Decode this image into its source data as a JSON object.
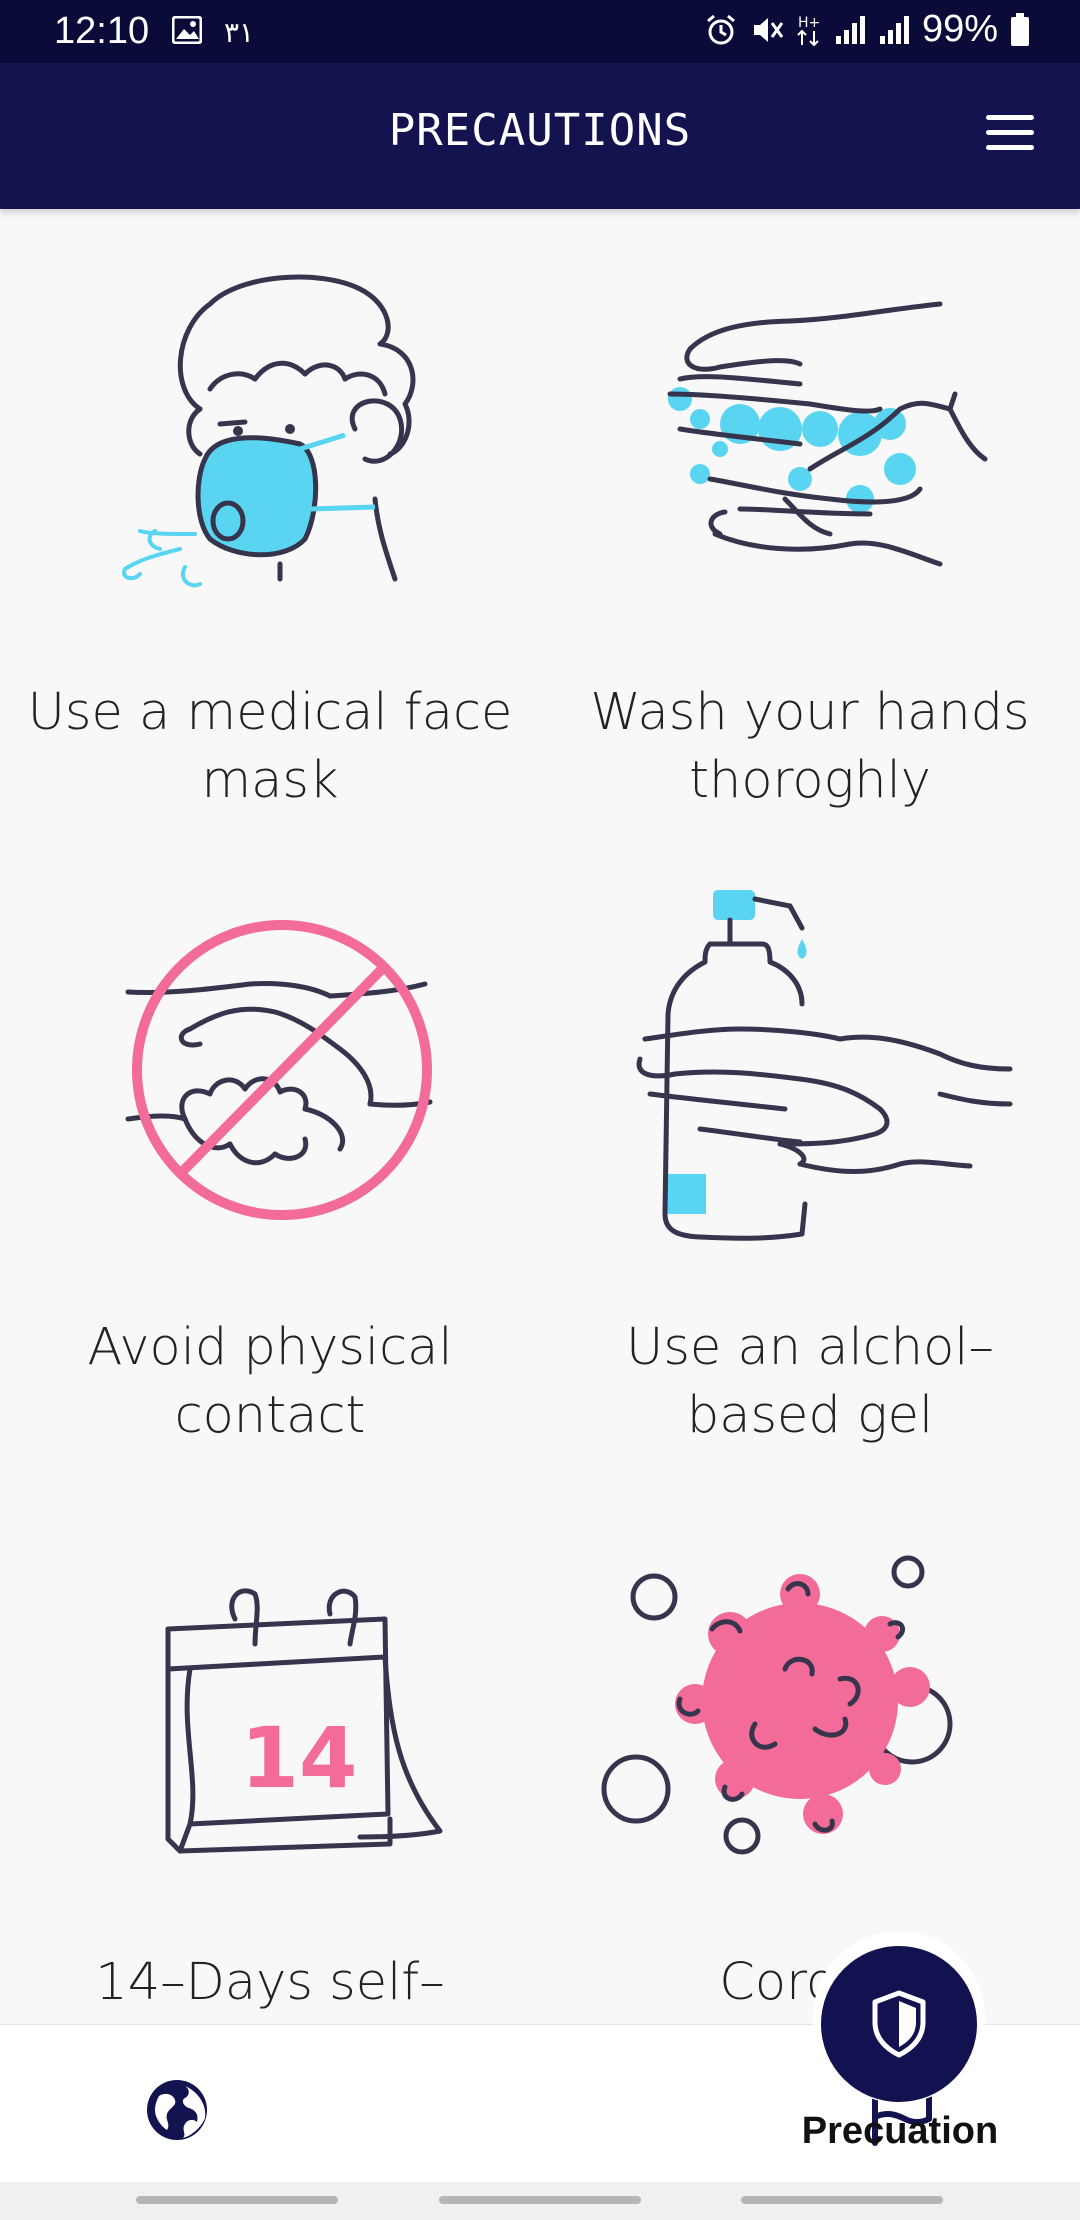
{
  "status_bar": {
    "time": "12:10",
    "arabic_number": "٣١",
    "battery": "99%"
  },
  "header": {
    "title": "PRECAUTIONS"
  },
  "cards": [
    {
      "label": "Use a medical face mask",
      "icon": "face-mask-icon"
    },
    {
      "label": "Wash your hands thoroghly",
      "icon": "hand-wash-icon"
    },
    {
      "label": "Avoid physical contact",
      "icon": "no-handshake-icon"
    },
    {
      "label": "Use an alchol–based gel",
      "icon": "hand-sanitizer-icon"
    },
    {
      "label": "14–Days self–",
      "icon": "calendar-icon"
    },
    {
      "label": "Corona",
      "icon": "virus-icon"
    }
  ],
  "calendar_number": "14",
  "bottom_nav": {
    "items": [
      {
        "icon": "globe-icon"
      },
      {
        "icon": "flag-icon"
      },
      {
        "icon": "shield-icon",
        "label": "Precuation",
        "active": true
      }
    ]
  },
  "colors": {
    "navy": "#131350",
    "accent_cyan": "#5ad5f1",
    "accent_pink": "#f36b98",
    "line_dark": "#37344e"
  }
}
